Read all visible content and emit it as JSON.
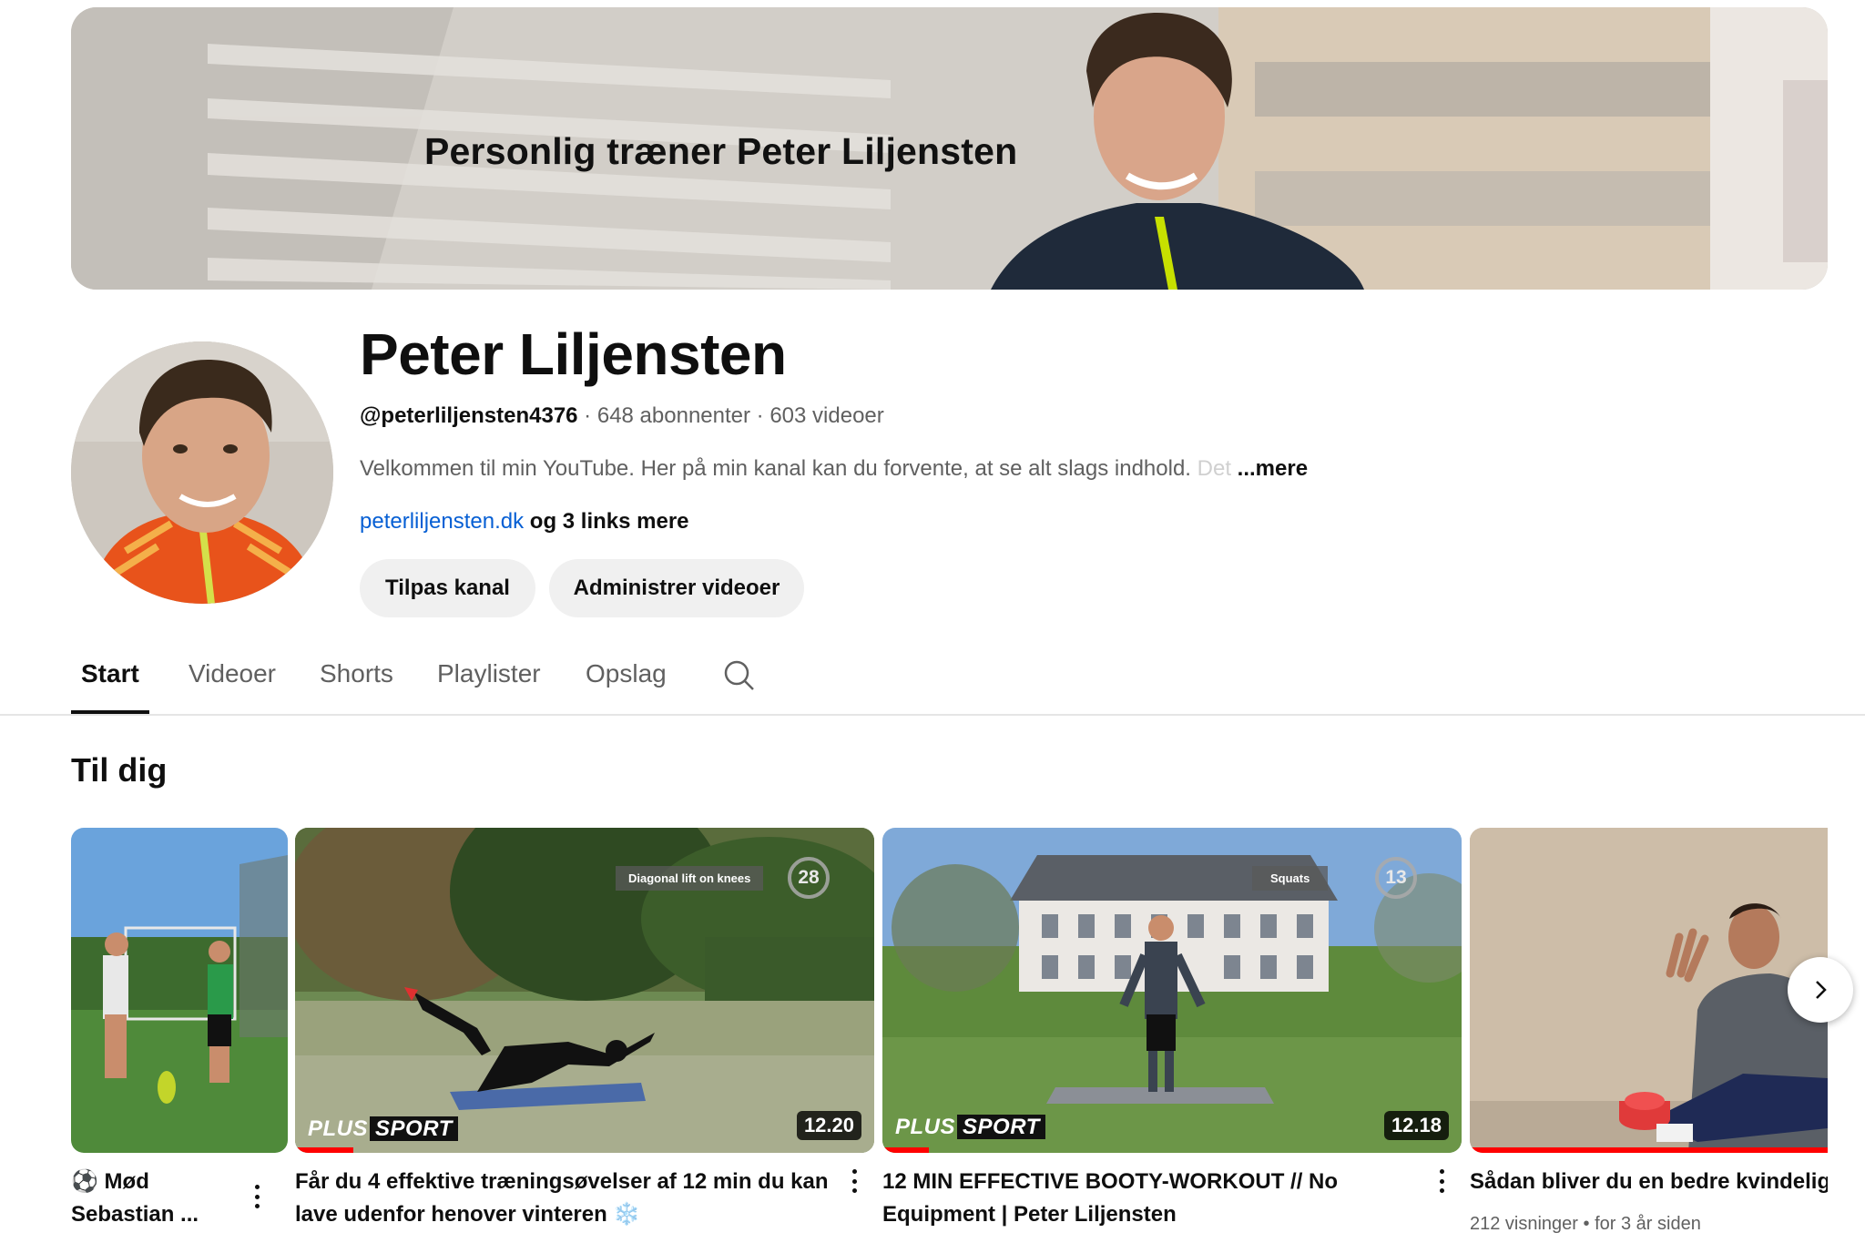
{
  "banner": {
    "title": "Personlig træner Peter Liljensten"
  },
  "channel": {
    "name": "Peter Liljensten",
    "handle": "@peterliljensten4376",
    "separator": " · ",
    "subscribers": "648 abonnenter",
    "videos": "603 videoer",
    "description": "Velkommen til min YouTube. Her på min kanal kan du forvente, at se alt slags indhold.",
    "description_fade": " Det",
    "more_label": "...mere",
    "link_text": "peterliljensten.dk",
    "more_links": " og 3 links mere"
  },
  "actions": {
    "customize": "Tilpas kanal",
    "manage": "Administrer videoer"
  },
  "tabs": [
    {
      "label": "Start",
      "active": true
    },
    {
      "label": "Videoer",
      "active": false
    },
    {
      "label": "Shorts",
      "active": false
    },
    {
      "label": "Playlister",
      "active": false
    },
    {
      "label": "Opslag",
      "active": false
    }
  ],
  "section": {
    "title": "Til dig"
  },
  "videos": [
    {
      "title_line1": "⚽ Mød",
      "title_line2": "Sebastian ..."
    },
    {
      "title_line1": "Får du 4 effektive træningsøvelser af 12 min du kan",
      "title_line2": "lave udenfor henover vinteren ❄️",
      "duration": "12.20",
      "overlay_label": "Diagonal lift on knees",
      "overlay_count": "28",
      "brand_plus": "PLUS",
      "brand_sport": "SPORT",
      "progress": 0.1
    },
    {
      "title_line1": "12 MIN EFFECTIVE BOOTY-WORKOUT // No",
      "title_line2": "Equipment | Peter Liljensten",
      "duration": "12.18",
      "overlay_label": "Squats",
      "overlay_count": "13",
      "brand_plus": "PLUS",
      "brand_sport": "SPORT",
      "progress": 0.08
    },
    {
      "title_line1": "Sådan bliver du en bedre kvindelig",
      "views": "212 visninger",
      "dot": " • ",
      "age": "for 3 år siden",
      "progress": 1.0
    }
  ],
  "icons": {
    "search": "search-icon",
    "more": "more-vert-icon",
    "next": "chevron-right-icon"
  },
  "colors": {
    "link": "#065fd4",
    "progress": "#ff0000",
    "button_bg": "#f0f0f0",
    "secondary_text": "#606060"
  }
}
